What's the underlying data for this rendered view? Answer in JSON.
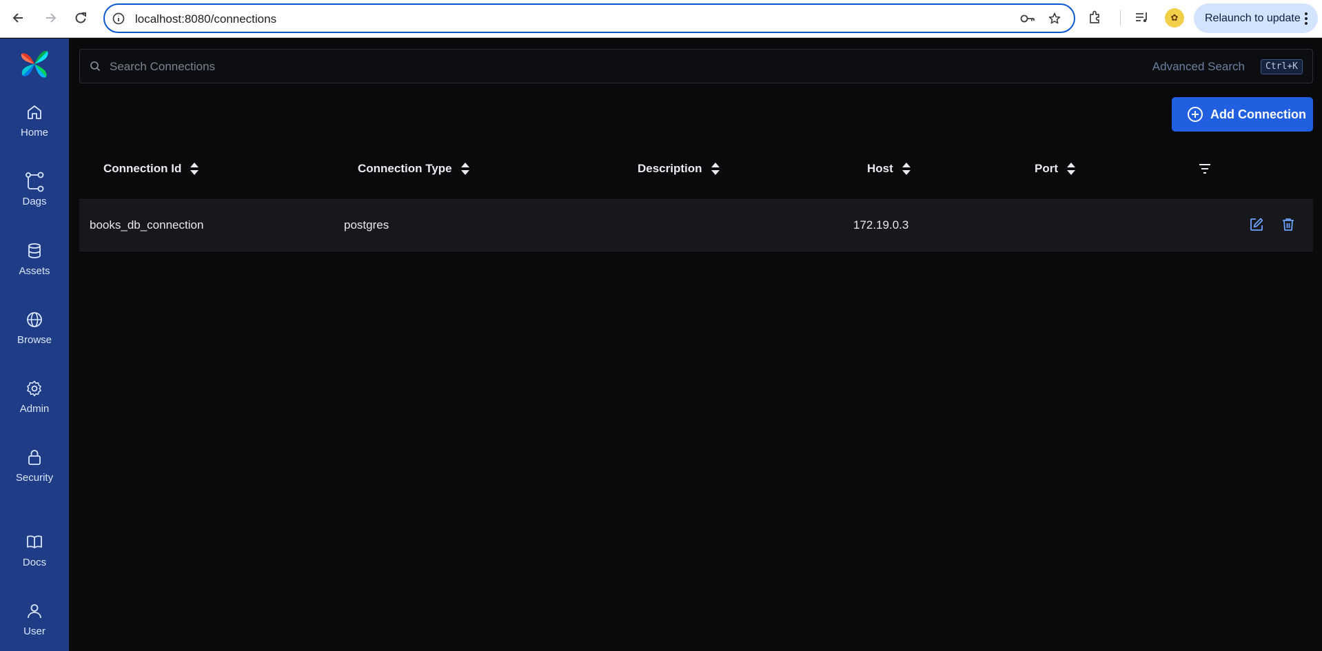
{
  "browser": {
    "url": "localhost:8080/connections",
    "relaunch_label": "Relaunch to update"
  },
  "sidebar": {
    "items": [
      {
        "label": "Home",
        "icon": "home-icon"
      },
      {
        "label": "Dags",
        "icon": "dags-icon"
      },
      {
        "label": "Assets",
        "icon": "database-icon"
      },
      {
        "label": "Browse",
        "icon": "globe-icon"
      },
      {
        "label": "Admin",
        "icon": "gear-icon"
      },
      {
        "label": "Security",
        "icon": "lock-icon"
      },
      {
        "label": "Docs",
        "icon": "book-icon"
      },
      {
        "label": "User",
        "icon": "user-icon"
      }
    ]
  },
  "search": {
    "placeholder": "Search Connections",
    "advanced_label": "Advanced Search",
    "shortcut": "Ctrl+K"
  },
  "toolbar": {
    "add_label": "Add Connection"
  },
  "table": {
    "columns": [
      "Connection Id",
      "Connection Type",
      "Description",
      "Host",
      "Port"
    ],
    "rows": [
      {
        "connection_id": "books_db_connection",
        "connection_type": "postgres",
        "description": "",
        "host": "172.19.0.3",
        "port": ""
      }
    ]
  },
  "colors": {
    "sidebar": "#1f3d87",
    "background": "#0a0a0d",
    "accent": "#1f5fe0"
  }
}
